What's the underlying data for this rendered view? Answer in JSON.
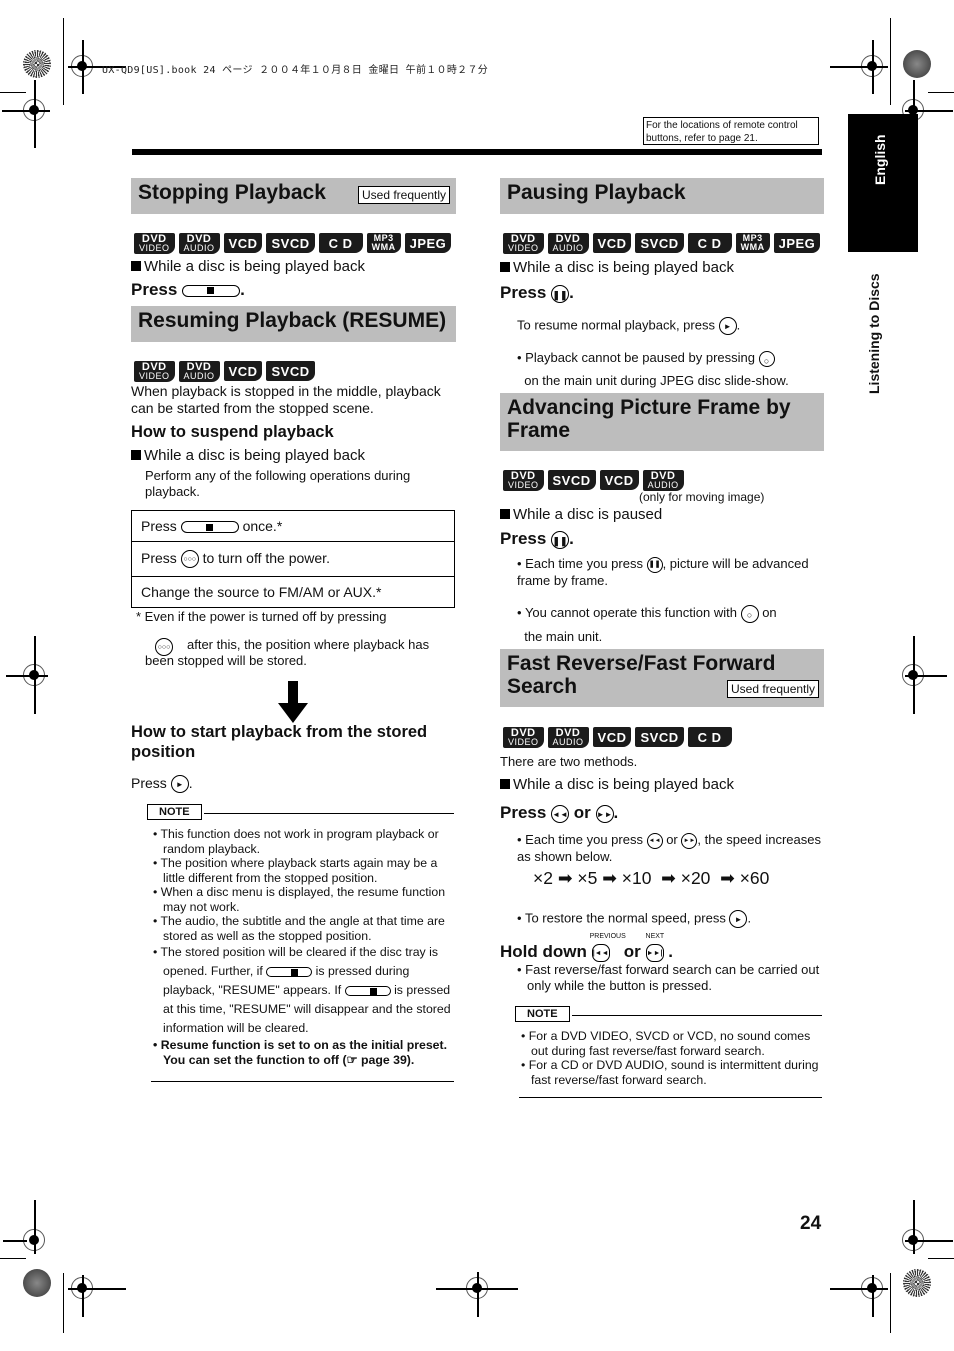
{
  "print_meta": "UX-QD9[US].book  24 ページ  ２００４年１０月８日  金曜日  午前１０時２７分",
  "reference_note": "For the locations of remote control buttons, refer to page 21.",
  "side_tab": {
    "language": "English",
    "section": "Listening to Discs"
  },
  "page_number": "24",
  "badge_labels": {
    "dvd_video": [
      "DVD",
      "VIDEO"
    ],
    "dvd_audio": [
      "DVD",
      "AUDIO"
    ],
    "vcd": "VCD",
    "svcd": "SVCD",
    "cd": "C D",
    "mp3wma": [
      "MP3",
      "WMA"
    ],
    "jpeg": "JPEG"
  },
  "used_frequently": "Used frequently",
  "stopping": {
    "title": "Stopping Playback",
    "condition": "While a disc is being played back",
    "press": "Press",
    "press_end": "."
  },
  "resuming": {
    "title": "Resuming Playback (RESUME)",
    "intro": "When playback is stopped in the middle, playback can be started from the stopped scene.",
    "suspend_heading": "How to suspend playback",
    "condition": "While a disc is being played back",
    "perform": "Perform any of the following operations during playback.",
    "table": [
      {
        "pre": "Press",
        "post": "once.*",
        "icon": "stop"
      },
      {
        "pre": "Press",
        "post": "to turn off the power.",
        "icon": "power"
      },
      {
        "pre": "Change the source to FM/AM or AUX.*",
        "post": "",
        "icon": ""
      }
    ],
    "footnote_1": "* Even if the power is turned off by pressing",
    "footnote_2": "after this, the position where playback has been stopped will be stored.",
    "power_label": "⏻/I AUDIO",
    "start_heading": "How to start playback from the stored position",
    "start_press": "Press",
    "note_label": "NOTE",
    "notes": [
      "This function does not work in program playback or random playback.",
      "The position where playback starts again may be a little different from the stopped position.",
      "When a disc menu is displayed, the resume function may not work.",
      "The audio, the subtitle and the angle at that time are stored as well as the stopped position."
    ],
    "note5_a": "The stored position will be cleared if the disc tray is opened. Further, if",
    "note5_b": "is pressed during playback, \"RESUME\" appears. If",
    "note5_c": "is pressed at this time, \"RESUME\" will disappear and the stored information will be cleared.",
    "note6": "Resume function is set to on as the initial preset. You can set the function to off",
    "note6_ref": "page 39)."
  },
  "pausing": {
    "title": "Pausing Playback",
    "condition": "While a disc is being played back",
    "press": "Press",
    "resume_text": "To resume normal playback, press",
    "bullet_a": "Playback cannot be paused by pressing",
    "bullet_b": "on the main unit during JPEG disc slide-show."
  },
  "advancing": {
    "title": "Advancing Picture Frame by Frame",
    "only_moving": "(only for moving image)",
    "condition": "While a disc is paused",
    "press": "Press",
    "bullet1_a": "Each time you press",
    "bullet1_b": ", picture will be advanced frame by frame.",
    "bullet2_a": "You cannot operate this function with",
    "bullet2_b": "on",
    "bullet2_c": "the main unit."
  },
  "fast_search": {
    "title": "Fast Reverse/Fast Forward Search",
    "intro": "There are two methods.",
    "condition": "While a disc is being played back",
    "press": "Press",
    "or": "or",
    "bullet1_a": "Each time you press",
    "bullet1_b": ", the speed increases as shown below.",
    "speeds": [
      "×2",
      "×5",
      "×10",
      "×20",
      "×60"
    ],
    "restore": "To restore the normal speed, press",
    "hold_down": "Hold down",
    "prev_label": "PREVIOUS",
    "next_label": "NEXT",
    "hold_note": "Fast reverse/fast forward search can be carried out only while the button is pressed.",
    "note_label": "NOTE",
    "notes": [
      "For a DVD VIDEO, SVCD or VCD, no sound comes out during fast reverse/fast forward search.",
      "For a CD or DVD AUDIO, sound is intermittent during fast reverse/fast forward search."
    ]
  }
}
